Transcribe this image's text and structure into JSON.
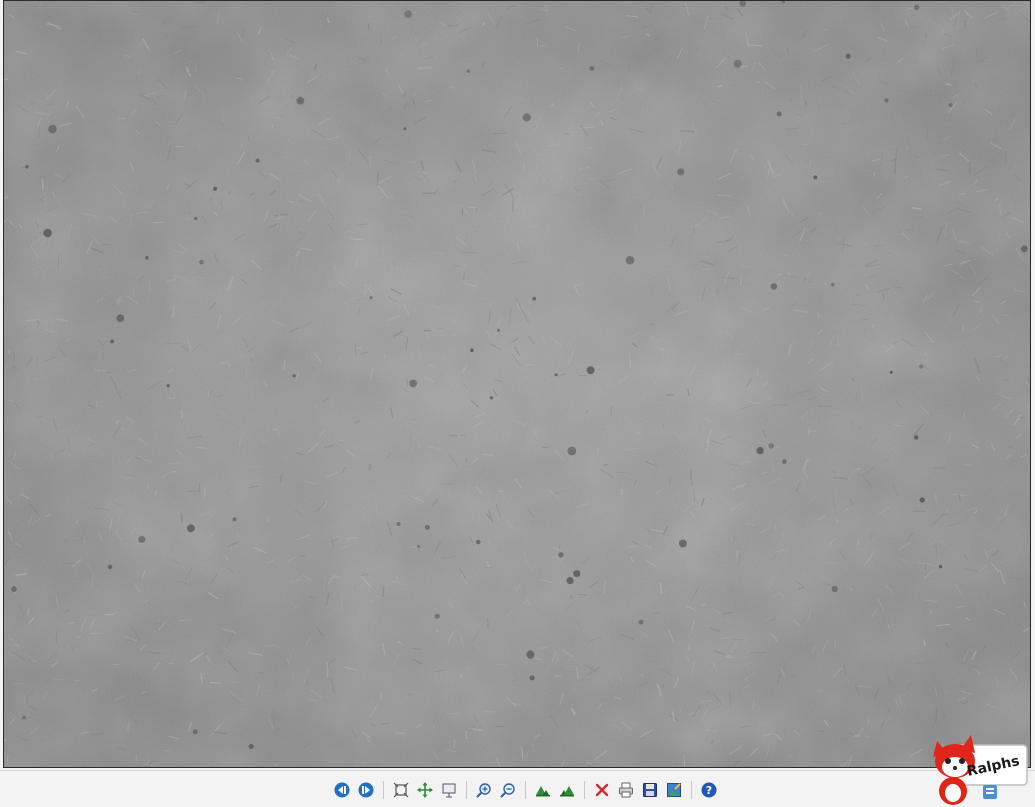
{
  "viewer": {
    "image": {
      "kind": "grayscale-microstructure-photo",
      "base_color": "#8e8e8e"
    }
  },
  "toolbar": {
    "buttons": [
      {
        "name": "previous-image-button",
        "icon": "previous-icon",
        "group": 1
      },
      {
        "name": "next-image-button",
        "icon": "next-icon",
        "group": 1
      },
      {
        "name": "fit-to-window-button",
        "icon": "fit-window-icon",
        "group": 2
      },
      {
        "name": "actual-size-button",
        "icon": "actual-size-icon",
        "group": 2
      },
      {
        "name": "slideshow-button",
        "icon": "slideshow-icon",
        "group": 2
      },
      {
        "name": "zoom-in-button",
        "icon": "zoom-in-icon",
        "group": 3
      },
      {
        "name": "zoom-out-button",
        "icon": "zoom-out-icon",
        "group": 3
      },
      {
        "name": "rotate-left-button",
        "icon": "rotate-left-icon",
        "group": 4
      },
      {
        "name": "rotate-right-button",
        "icon": "rotate-right-icon",
        "group": 4
      },
      {
        "name": "delete-button",
        "icon": "delete-icon",
        "group": 5
      },
      {
        "name": "print-button",
        "icon": "print-icon",
        "group": 5
      },
      {
        "name": "save-button",
        "icon": "save-icon",
        "group": 5
      },
      {
        "name": "edit-image-button",
        "icon": "edit-image-icon",
        "group": 5
      },
      {
        "name": "help-button",
        "icon": "help-icon",
        "group": 6
      }
    ],
    "colors": {
      "nav_blue": "#1f6fc5",
      "delete_red": "#d12a2a",
      "rotate_green": "#2e8b3a",
      "help_blue": "#2058b8"
    }
  },
  "mascot": {
    "kind": "fox-mascot-logo",
    "logo_text": "Ralphs",
    "fox_color": "#e0261b"
  }
}
